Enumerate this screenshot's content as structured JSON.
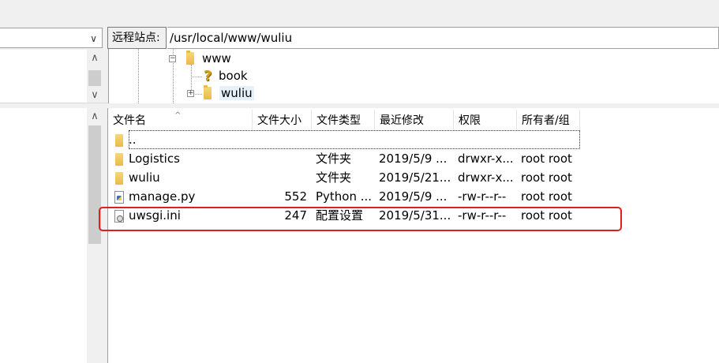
{
  "local": {
    "combo_arrow": "∨",
    "tree_scroll_up": "∧",
    "tree_scroll_down": "∨",
    "list_scroll_up": "∧"
  },
  "remote": {
    "label": "远程站点:",
    "path": "/usr/local/www/wuliu",
    "tree": [
      {
        "name": "www",
        "toggle": "−",
        "icon": "folder-icon"
      },
      {
        "name": "book",
        "icon": "question-icon"
      },
      {
        "name": "wuliu",
        "toggle": "+",
        "icon": "folder-icon",
        "selected": true
      }
    ],
    "columns": [
      "文件名",
      "文件大小",
      "文件类型",
      "最近修改",
      "权限",
      "所有者/组"
    ],
    "sort_indicator": "^",
    "files": [
      {
        "name": "..",
        "size": "",
        "type": "",
        "modified": "",
        "perms": "",
        "owner": "",
        "icon": "folder-icon"
      },
      {
        "name": "Logistics",
        "size": "",
        "type": "文件夹",
        "modified": "2019/5/9 ...",
        "perms": "drwxr-x...",
        "owner": "root root",
        "icon": "folder-icon"
      },
      {
        "name": "wuliu",
        "size": "",
        "type": "文件夹",
        "modified": "2019/5/21...",
        "perms": "drwxr-x...",
        "owner": "root root",
        "icon": "folder-icon"
      },
      {
        "name": "manage.py",
        "size": "552",
        "type": "Python ...",
        "modified": "2019/5/9 ...",
        "perms": "-rw-r--r--",
        "owner": "root root",
        "icon": "python-file-icon"
      },
      {
        "name": "uwsgi.ini",
        "size": "247",
        "type": "配置设置",
        "modified": "2019/5/31...",
        "perms": "-rw-r--r--",
        "owner": "root root",
        "icon": "config-file-icon"
      }
    ]
  },
  "colors": {
    "highlight": "#e01e1e",
    "selection": "#e5f1fb",
    "folder": "#f8d775"
  }
}
